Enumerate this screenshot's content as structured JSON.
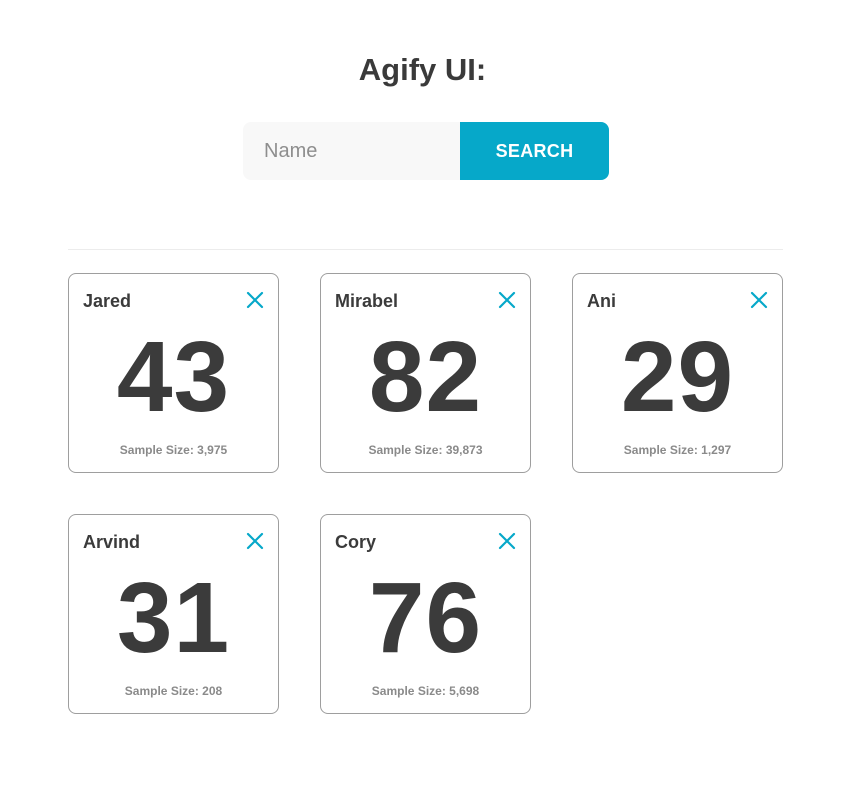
{
  "header": {
    "title": "Agify UI:"
  },
  "search": {
    "placeholder": "Name",
    "value": "",
    "button_label": "SEARCH"
  },
  "colors": {
    "accent": "#06a8c9",
    "text": "#3b3b3b",
    "muted": "#8a8a8a",
    "border": "#9e9e9e"
  },
  "cards": [
    {
      "name": "Jared",
      "age": "43",
      "sample_label": "Sample Size:",
      "sample_size": "3,975",
      "close_icon": "close-icon"
    },
    {
      "name": "Mirabel",
      "age": "82",
      "sample_label": "Sample Size:",
      "sample_size": "39,873",
      "close_icon": "close-icon"
    },
    {
      "name": "Ani",
      "age": "29",
      "sample_label": "Sample Size:",
      "sample_size": "1,297",
      "close_icon": "close-icon"
    },
    {
      "name": "Arvind",
      "age": "31",
      "sample_label": "Sample Size:",
      "sample_size": "208",
      "close_icon": "close-icon"
    },
    {
      "name": "Cory",
      "age": "76",
      "sample_label": "Sample Size:",
      "sample_size": "5,698",
      "close_icon": "close-icon"
    }
  ]
}
